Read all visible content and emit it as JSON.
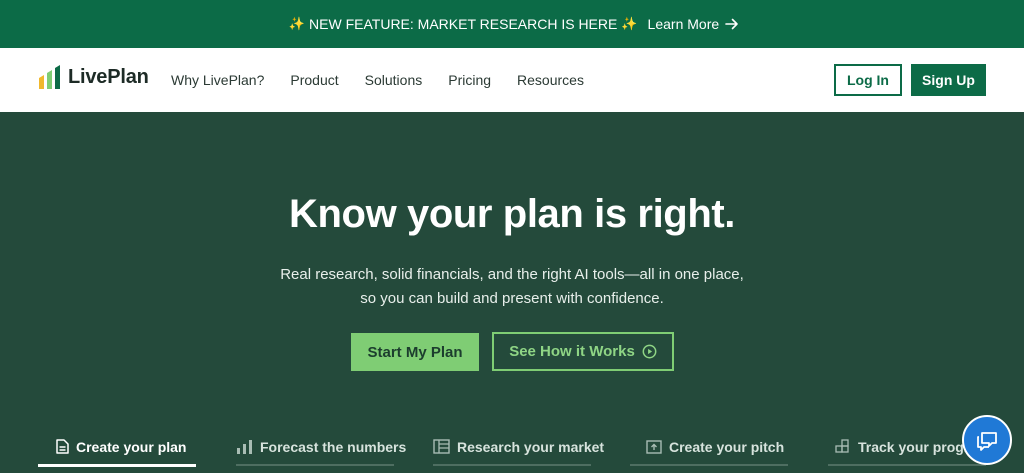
{
  "banner": {
    "text": "NEW FEATURE: MARKET RESEARCH IS HERE",
    "sparkle": "✨",
    "learn_more": "Learn More"
  },
  "nav": {
    "logo_text": "LivePlan",
    "items": [
      "Why LivePlan?",
      "Product",
      "Solutions",
      "Pricing",
      "Resources"
    ],
    "login": "Log In",
    "signup": "Sign Up"
  },
  "hero": {
    "title": "Know your plan is right.",
    "subtitle_line1": "Real research, solid financials, and the right AI tools—all in one place,",
    "subtitle_line2": "so you can build and present with confidence.",
    "primary_cta": "Start My Plan",
    "secondary_cta": "See How it Works"
  },
  "tabs": [
    {
      "label": "Create your plan",
      "icon": "document-icon",
      "active": true
    },
    {
      "label": "Forecast the numbers",
      "icon": "bar-chart-icon",
      "active": false
    },
    {
      "label": "Research your market",
      "icon": "building-icon",
      "active": false
    },
    {
      "label": "Create your pitch",
      "icon": "presentation-icon",
      "active": false
    },
    {
      "label": "Track your progress",
      "icon": "grid-icon",
      "active": false
    }
  ],
  "colors": {
    "brand_green": "#0c6b47",
    "hero_bg": "#244a3b",
    "cta_green": "#7fcd74",
    "chat_blue": "#2079d6"
  }
}
